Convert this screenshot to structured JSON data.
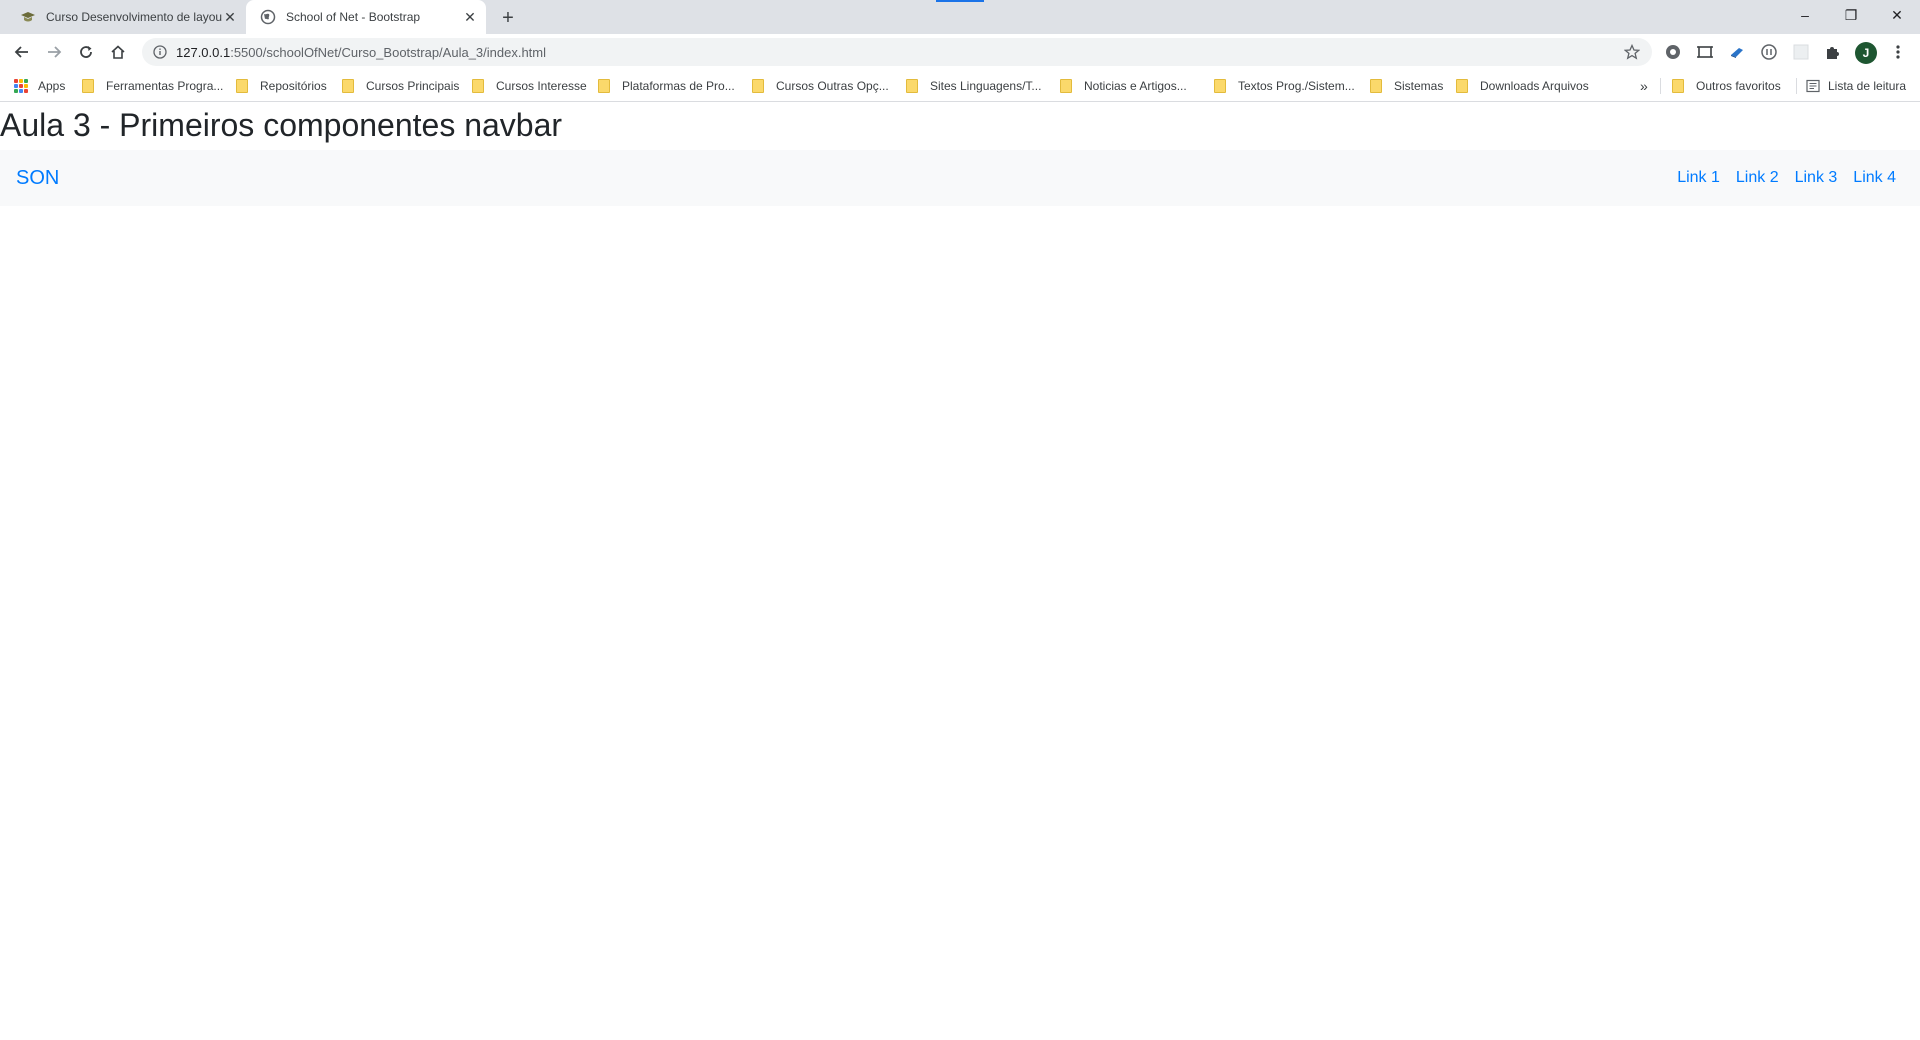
{
  "browser": {
    "tabs": [
      {
        "title": "Curso Desenvolvimento de layouts",
        "active": false
      },
      {
        "title": "School of Net - Bootstrap",
        "active": true
      }
    ],
    "new_tab_symbol": "+",
    "window_controls": {
      "minimize": "–",
      "restore": "❐",
      "close": "✕"
    }
  },
  "toolbar": {
    "url_host": "127.0.0.1",
    "url_rest": ":5500/schoolOfNet/Curso_Bootstrap/Aula_3/index.html",
    "avatar_letter": "J"
  },
  "bookmarks": {
    "apps_label": "Apps",
    "items": [
      "Ferramentas Progra...",
      "Repositórios",
      "Cursos Principais",
      "Cursos Interesse",
      "Plataformas de Pro...",
      "Cursos Outras Opç...",
      "Sites Linguagens/T...",
      "Noticias e Artigos...",
      "Textos Prog./Sistem...",
      "Sistemas",
      "Downloads Arquivos"
    ],
    "overflow": "»",
    "other_favorites": "Outros favoritos",
    "reading_list": "Lista de leitura"
  },
  "page": {
    "title": "Aula 3 - Primeiros componentes navbar",
    "navbar": {
      "brand": "SON",
      "links": [
        "Link 1",
        "Link 2",
        "Link 3",
        "Link 4"
      ]
    }
  },
  "colors": {
    "link": "#007bff",
    "navbar_bg": "#f8f9fa",
    "heading": "#212529",
    "tabstrip": "#dee1e6"
  }
}
